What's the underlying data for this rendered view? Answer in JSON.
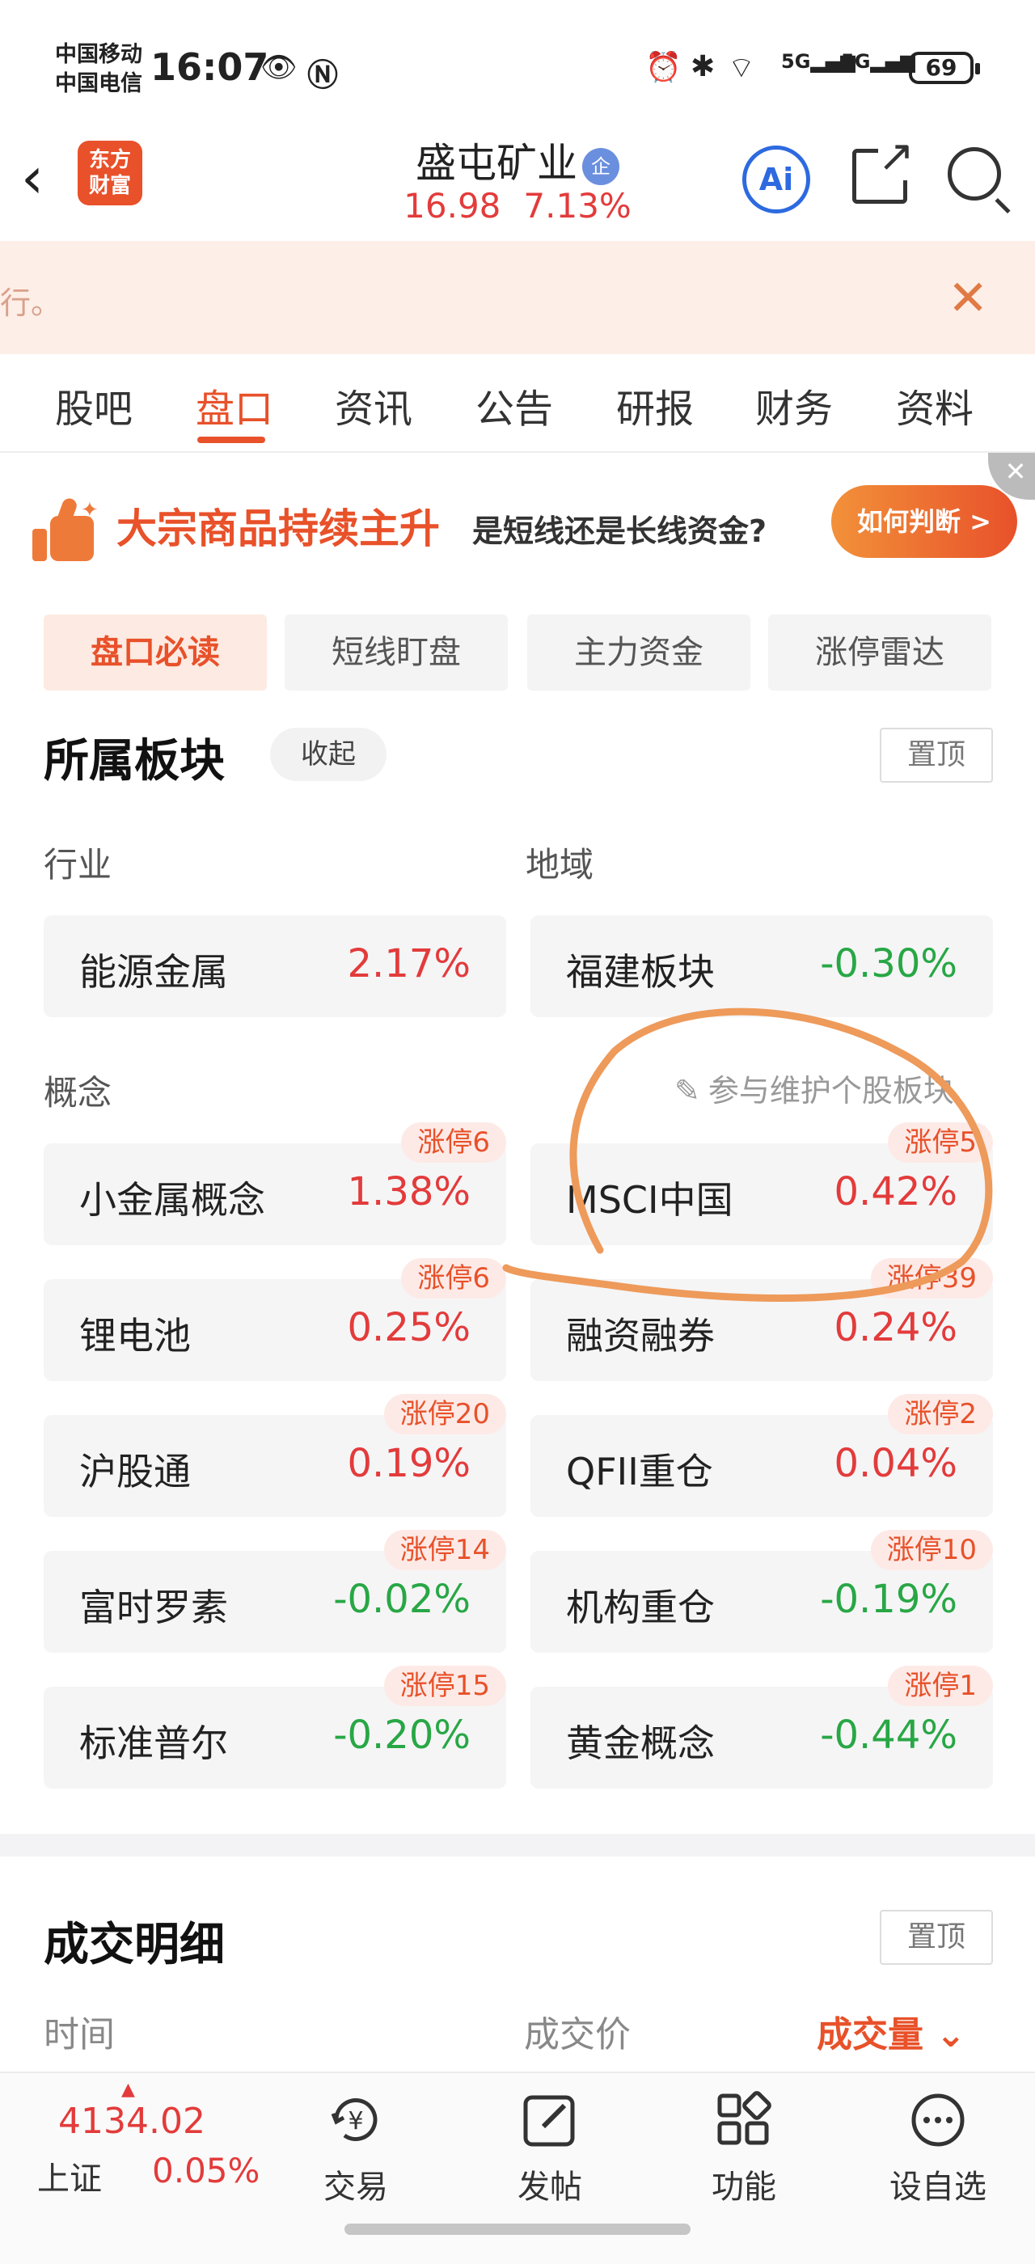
{
  "status_bar": {
    "carrier_1": "中国移动",
    "carrier_2": "中国电信",
    "time": "16:07",
    "sig_1": "5G",
    "sig_2": "5G",
    "battery": "69"
  },
  "header": {
    "logo_line1": "东方",
    "logo_line2": "财富",
    "stock_name": "盛屯矿业",
    "badge": "企",
    "price": "16.98",
    "change_pct": "7.13%",
    "ai_label": "Ai"
  },
  "notice": {
    "text": "行。"
  },
  "tabs": [
    "股吧",
    "盘口",
    "资讯",
    "公告",
    "研报",
    "财务",
    "资料"
  ],
  "active_tab": "盘口",
  "promo": {
    "title": "大宗商品持续主升",
    "subtitle": "是短线还是长线资金?",
    "button": "如何判断 >"
  },
  "sub_tabs": [
    "盘口必读",
    "短线盯盘",
    "主力资金",
    "涨停雷达"
  ],
  "sector": {
    "title": "所属板块",
    "collapse": "收起",
    "pin": "置顶",
    "industry_label": "行业",
    "region_label": "地域",
    "concept_label": "概念",
    "maintain": "参与维护个股板块",
    "industry": {
      "name": "能源金属",
      "pct": "2.17%"
    },
    "region": {
      "name": "福建板块",
      "pct": "-0.30%"
    },
    "concepts": [
      {
        "name": "小金属概念",
        "pct": "1.38%",
        "badge": "涨停6"
      },
      {
        "name": "MSCI中国",
        "pct": "0.42%",
        "badge": "涨停5"
      },
      {
        "name": "锂电池",
        "pct": "0.25%",
        "badge": "涨停6"
      },
      {
        "name": "融资融券",
        "pct": "0.24%",
        "badge": "涨停39"
      },
      {
        "name": "沪股通",
        "pct": "0.19%",
        "badge": "涨停20"
      },
      {
        "name": "QFII重仓",
        "pct": "0.04%",
        "badge": "涨停2"
      },
      {
        "name": "富时罗素",
        "pct": "-0.02%",
        "badge": "涨停14"
      },
      {
        "name": "机构重仓",
        "pct": "-0.19%",
        "badge": "涨停10"
      },
      {
        "name": "标准普尔",
        "pct": "-0.20%",
        "badge": "涨停15"
      },
      {
        "name": "黄金概念",
        "pct": "-0.44%",
        "badge": "涨停1"
      }
    ]
  },
  "detail": {
    "title": "成交明细",
    "pin": "置顶",
    "col_time": "时间",
    "col_price": "成交价",
    "col_volume": "成交量"
  },
  "bottom": {
    "index_value": "4134.02",
    "index_name": "上证",
    "index_pct": "0.05%",
    "nav": [
      "交易",
      "发帖",
      "功能",
      "设自选"
    ],
    "trade_icon_glyph": "¥"
  },
  "colors": {
    "accent": "#e8512a",
    "up": "#e33b3b",
    "down": "#28a745",
    "annotation": "#ee9a5a"
  }
}
